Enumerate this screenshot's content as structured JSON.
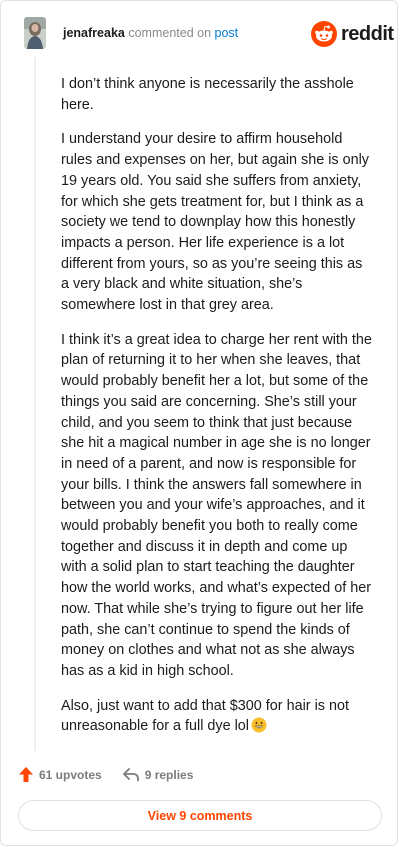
{
  "header": {
    "username": "jenafreaka",
    "action": "commented on",
    "post_link": "post"
  },
  "logo": {
    "text": "reddit",
    "color": "#ff4500"
  },
  "comment": {
    "paragraphs": [
      "I don’t think anyone is necessarily the asshole here.",
      "I understand your desire to affirm household rules and expenses on her, but again she is only 19 years old. You said she suffers from anxiety, for which she gets treatment for, but I think as a society we tend to downplay how this honestly impacts a person. Her life experience is a lot different from yours, so as you’re seeing this as a very black and white situation, she’s somewhere lost in that grey area.",
      "I think it’s a great idea to charge her rent with the plan of returning it to her when she leaves, that would probably benefit her a lot, but some of the things you said are concerning. She’s still your child, and you seem to think that just because she hit a magical number in age she is no longer in need of a parent, and now is responsible for your bills. I think the answers fall somewhere in between you and your wife’s approaches, and it would probably benefit you both to really come together and discuss it in depth and come up with a solid plan to start teaching the daughter how the world works, and what’s expected of her now. That while she’s trying to figure out her life path, she can’t continue to spend the kinds of money on clothes and what not as she always has as a kid in high school.",
      "Also, just want to add that $300 for hair is not unreasonable for a full dye lol"
    ],
    "emoji_icon": "grinning-face-icon"
  },
  "footer": {
    "upvotes": "61 upvotes",
    "replies": "9 replies",
    "upvote_color": "#ff4500"
  },
  "view_comments_button": "View 9 comments"
}
